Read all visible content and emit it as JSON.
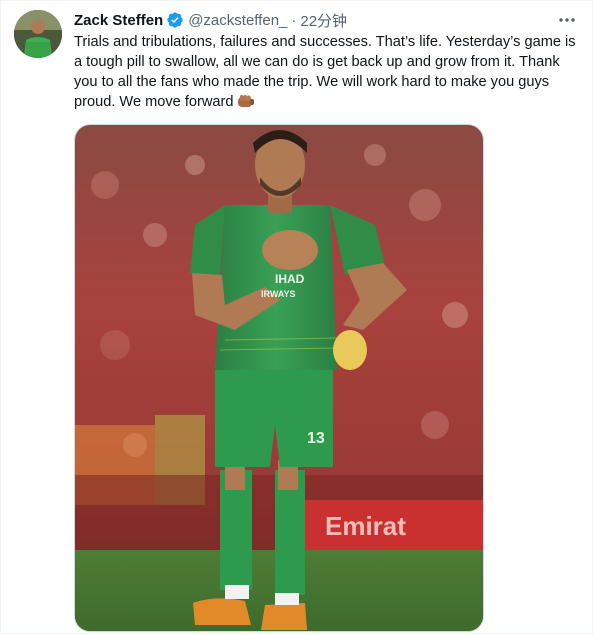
{
  "tweet": {
    "author_name": "Zack Steffen",
    "author_handle": "@zacksteffen_",
    "separator": "·",
    "timestamp": "22分钟",
    "text": "Trials and tribulations, failures and successes. That’s life. Yesterday’s game is a tough pill to swallow, all we can do is get back up and grow from it. Thank you to all the fans who made the trip. We will work hard to make you guys proud. We move forward",
    "emoji": "fist-bump",
    "verified": true
  },
  "photo": {
    "shirt_sponsor": "IHAD",
    "shirt_sponsor_line2": "IRWAYS",
    "shorts_number": "13",
    "ad_board_text": "Emirat"
  },
  "icons": {
    "verified_badge": "verified-badge-icon",
    "more": "more-options-icon",
    "emoji": "fist-emoji-icon"
  },
  "colors": {
    "name": "#0f1419",
    "secondary": "#536471",
    "verified": "#1d9bf0",
    "kit_green": "#2e8b4a",
    "crowd_red": "#b6393a"
  }
}
